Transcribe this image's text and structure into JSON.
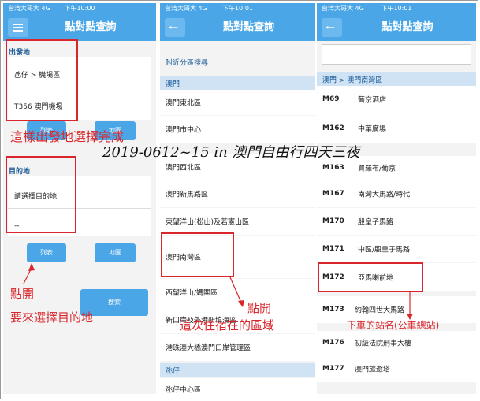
{
  "status": {
    "carrier": "台湾大哥大  4G",
    "times": [
      "下午10:00",
      "下午10:01",
      "下午10:01"
    ]
  },
  "nav_title": "點對點查詢",
  "panel1": {
    "origin_header": "出發地",
    "origin_line1": "氹仔 > 機場區",
    "origin_line2": "T356 澳門機場",
    "dest_header": "目的地",
    "dest_placeholder": "請選擇目的地",
    "dest_dash": "--",
    "list_button": "列表",
    "map_button": "地圖",
    "search_button": "搜索"
  },
  "panel2": {
    "nearby": "附近分區搜尋",
    "category1": "澳門",
    "items": [
      "澳門東北區",
      "澳門市中心",
      "澳門西北區",
      "澳門新馬路區",
      "東望洋山(松山)及若憲山區",
      "澳門南灣區",
      "西望洋山/媽閣區",
      "新口岸及外港新填海區",
      "港珠澳大橋澳門口岸管理區"
    ],
    "category2": "氹仔",
    "items2": [
      "氹仔中心區"
    ]
  },
  "panel3": {
    "search_value": "",
    "breadcrumb": "澳門 > 澳門南灣區",
    "routes": [
      {
        "code": "M69",
        "stop": "葡京酒店"
      },
      {
        "code": "M162",
        "stop": "中華廣場"
      },
      {
        "code": "M163",
        "stop": "賈羅布/葡京"
      },
      {
        "code": "M167",
        "stop": "南灣大馬路/時代"
      },
      {
        "code": "M170",
        "stop": "殷皇子馬路"
      },
      {
        "code": "M171",
        "stop": "中區/殷皇子馬路"
      },
      {
        "code": "M172",
        "stop": "亞馬喇前地"
      },
      {
        "code": "M173",
        "stop": "約翰四世大馬路"
      },
      {
        "code": "M176",
        "stop": "初級法院刑事大樓"
      },
      {
        "code": "M177",
        "stop": "澳門旅遊塔"
      }
    ]
  },
  "annotations": {
    "origin_done": "這樣出發地選擇完成",
    "tap1": "點開",
    "choose_dest": "要來選擇目的地",
    "tap2": "點開",
    "district": "這次住宿在的區域",
    "stop_name": "下車的站名(公車總站)",
    "banner": "2019-0612~15 in 澳門自由行四天三夜"
  },
  "colors": {
    "accent": "#4aa6e6",
    "annotation": "#d9262c",
    "category_bg": "#cfe3f5"
  }
}
